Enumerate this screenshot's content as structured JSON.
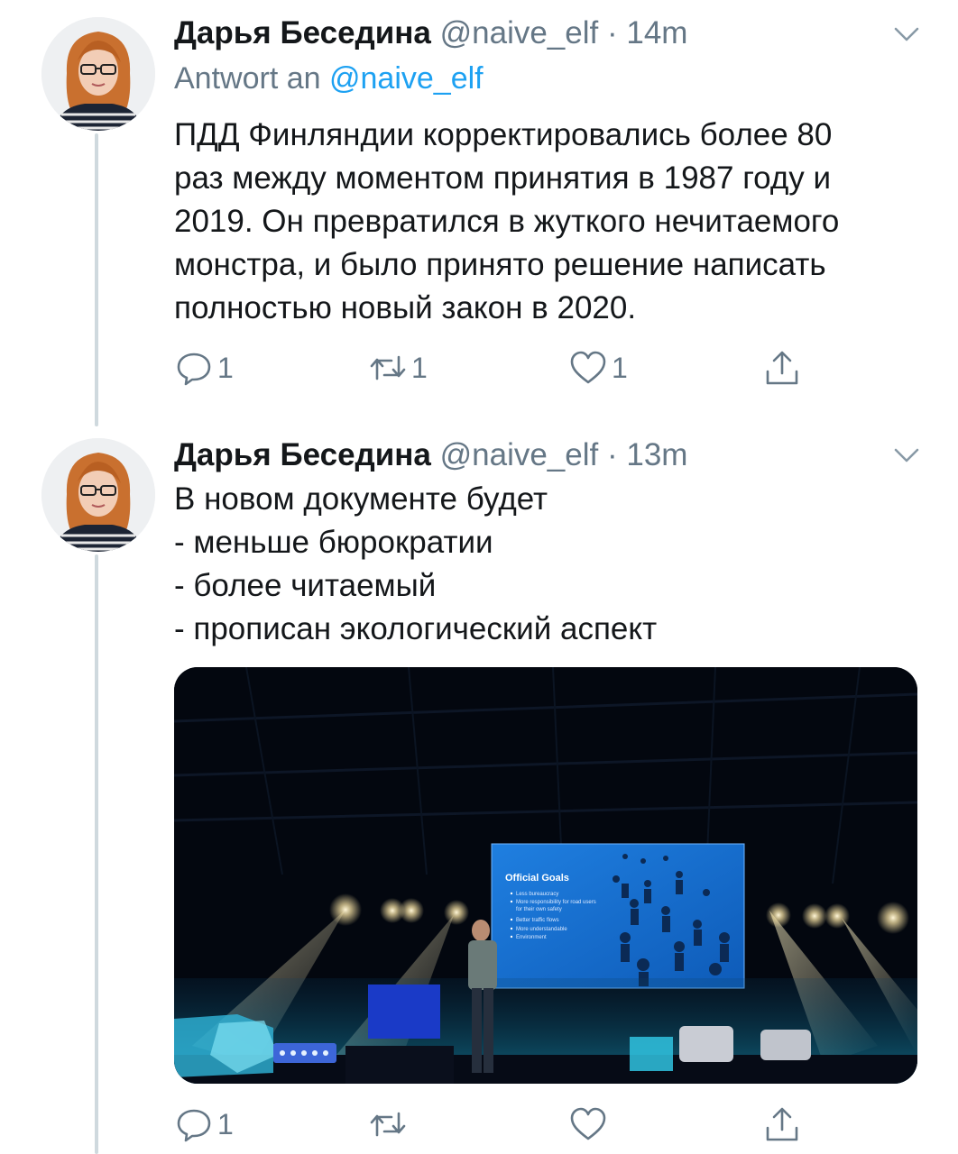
{
  "tweets": [
    {
      "author_name": "Дарья Беседина",
      "handle": "@naive_elf",
      "time": "· 14m",
      "reply_prefix": "Antwort an",
      "reply_handle": "@naive_elf",
      "text_lines": [
        "ПДД Финляндии корректировались более 80",
        "раз между моментом принятия в 1987 году и",
        "2019. Он превратился в жуткого нечитаемого",
        "монстра, и было принято решение написать",
        "полностью новый закон в 2020."
      ],
      "reply_count": "1",
      "retweet_count": "1",
      "like_count": "1"
    },
    {
      "author_name": "Дарья Беседина",
      "handle": "@naive_elf",
      "time": "· 13m",
      "text_lines": [
        "В новом документе будет",
        "- меньше бюрократии",
        "- более читаемый",
        "- прописан экологический аспект"
      ],
      "reply_count": "1",
      "retweet_count": "",
      "like_count": "",
      "media": {
        "slide_title": "Official Goals",
        "slide_bullets": [
          "Less bureaucracy",
          "More responsibility for road users",
          "for their own safety",
          "Better traffic flows",
          "More understandable",
          "Environment"
        ]
      }
    }
  ],
  "colors": {
    "link": "#1da1f2",
    "meta": "#657786",
    "text": "#14171a",
    "thread_line": "#cfd9de"
  }
}
